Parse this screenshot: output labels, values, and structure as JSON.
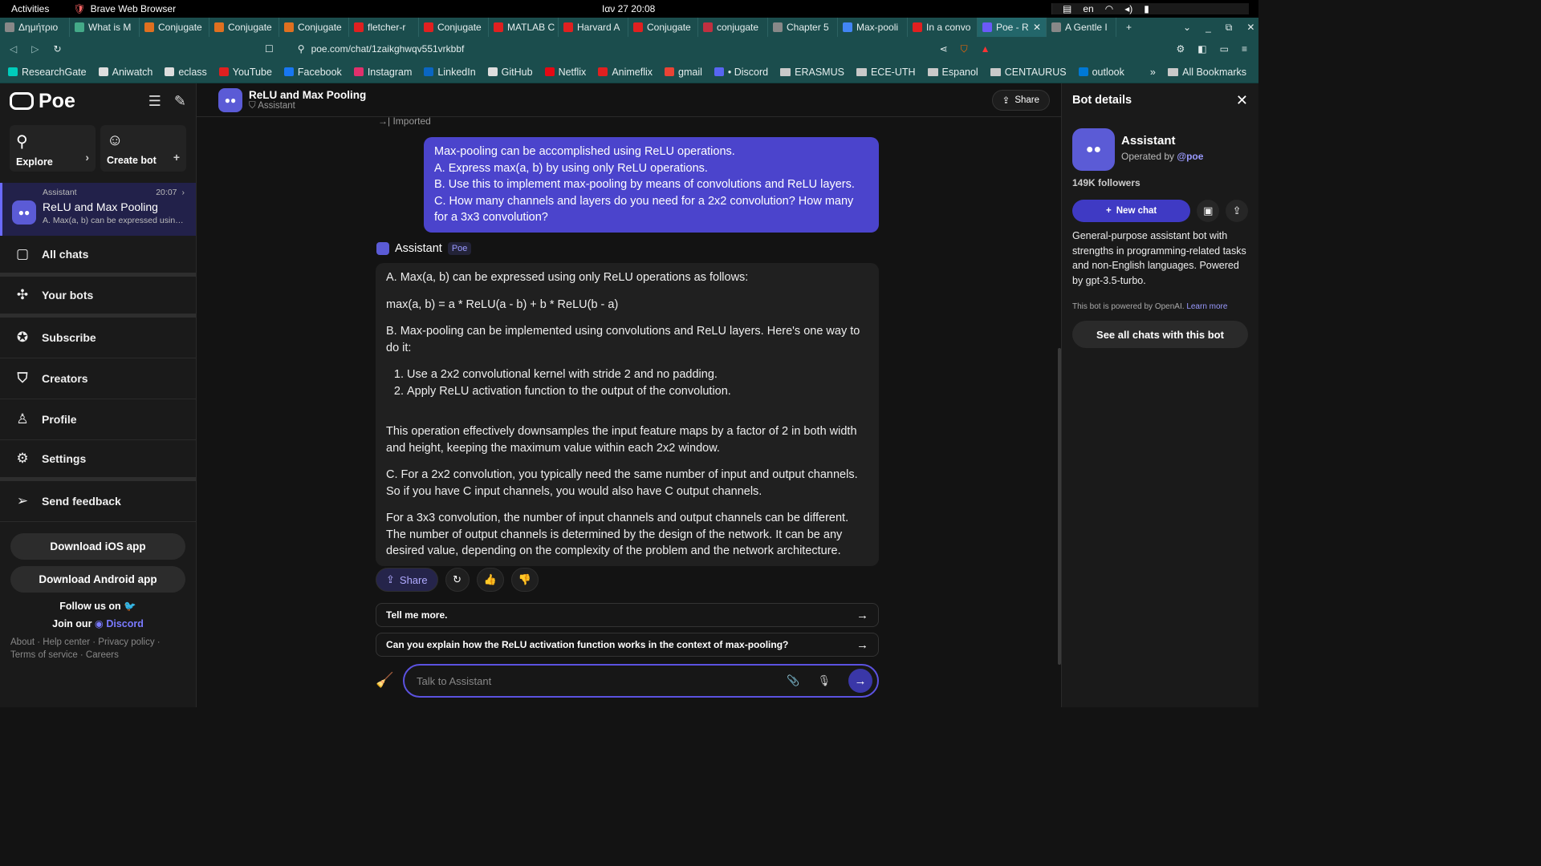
{
  "system": {
    "activities": "Activities",
    "app_name": "Brave Web Browser",
    "clock": "Ιαν 27  20:08",
    "lang": "en"
  },
  "tabs": [
    {
      "label": "Δημήτριο",
      "color": "#888"
    },
    {
      "label": "What is M",
      "color": "#4a8"
    },
    {
      "label": "Conjugate",
      "color": "#e07020"
    },
    {
      "label": "Conjugate",
      "color": "#e07020"
    },
    {
      "label": "Conjugate",
      "color": "#e07020"
    },
    {
      "label": "fletcher-r",
      "color": "#e02020"
    },
    {
      "label": "Conjugate",
      "color": "#e02020"
    },
    {
      "label": "MATLAB C",
      "color": "#e02020"
    },
    {
      "label": "Harvard A",
      "color": "#e02020"
    },
    {
      "label": "Conjugate",
      "color": "#e02020"
    },
    {
      "label": "conjugate",
      "color": "#c03040"
    },
    {
      "label": "Chapter 5",
      "color": "#888"
    },
    {
      "label": "Max-pooli",
      "color": "#4285f4"
    },
    {
      "label": "In a convo",
      "color": "#e02020"
    },
    {
      "label": "Poe - R",
      "color": "#6a5af9",
      "active": true
    },
    {
      "label": "A Gentle I",
      "color": "#888"
    }
  ],
  "url": "poe.com/chat/1zaikghwqv551vrkbbf",
  "bookmarks": [
    {
      "label": "ResearchGate",
      "color": "#00ccbb"
    },
    {
      "label": "Aniwatch",
      "color": "#ddd"
    },
    {
      "label": "eclass",
      "color": "#ddd"
    },
    {
      "label": "YouTube",
      "color": "#e02020"
    },
    {
      "label": "Facebook",
      "color": "#1877f2"
    },
    {
      "label": "Instagram",
      "color": "#e1306c"
    },
    {
      "label": "LinkedIn",
      "color": "#0a66c2"
    },
    {
      "label": "GitHub",
      "color": "#ddd"
    },
    {
      "label": "Netflix",
      "color": "#e50914"
    },
    {
      "label": "Animeflix",
      "color": "#e02020"
    },
    {
      "label": "gmail",
      "color": "#ea4335"
    },
    {
      "label": "• Discord",
      "color": "#5865f2"
    },
    {
      "label": "ERASMUS",
      "folder": true
    },
    {
      "label": "ECE-UTH",
      "folder": true
    },
    {
      "label": "Espanol",
      "folder": true
    },
    {
      "label": "CENTAURUS",
      "folder": true
    },
    {
      "label": "outlook",
      "color": "#0078d4"
    },
    {
      "label": "»",
      "folder": false,
      "color": "transparent"
    },
    {
      "label": "All Bookmarks",
      "folder": true
    }
  ],
  "sidebar": {
    "logo": "Poe",
    "explore": "Explore",
    "create_bot": "Create bot",
    "conversation": {
      "bot": "Assistant",
      "time": "20:07",
      "title": "ReLU and Max Pooling",
      "preview": "A. Max(a, b) can be expressed using on..."
    },
    "nav": [
      {
        "label": "All chats",
        "icon": "chats-icon"
      },
      {
        "label": "Your bots",
        "icon": "bots-icon"
      },
      {
        "label": "Subscribe",
        "icon": "subscribe-icon"
      },
      {
        "label": "Creators",
        "icon": "creators-icon"
      },
      {
        "label": "Profile",
        "icon": "profile-icon"
      },
      {
        "label": "Settings",
        "icon": "settings-icon"
      },
      {
        "label": "Send feedback",
        "icon": "send-icon"
      }
    ],
    "download_ios": "Download iOS app",
    "download_android": "Download Android app",
    "follow_us": "Follow us on",
    "join_our": "Join our",
    "discord": "Discord",
    "footer_line1": "About · Help center · Privacy policy ·",
    "footer_line2": "Terms of service · Careers"
  },
  "chat": {
    "title": "ReLU and Max Pooling",
    "subtitle": "Assistant",
    "share": "Share",
    "imported": "Imported",
    "user_message": [
      "Max-pooling can be accomplished using ReLU operations.",
      "A. Express max(a, b) by using only ReLU operations.",
      "B. Use this to implement max-pooling by means of convolutions and ReLU layers.",
      "C. How many channels and layers do you need for a 2x2 convolution? How many for a 3x3 convolution?"
    ],
    "bot_name": "Assistant",
    "bot_tag": "Poe",
    "bot_p1": "A. Max(a, b) can be expressed using only ReLU operations as follows:",
    "bot_p2": "max(a, b) = a * ReLU(a - b) + b * ReLU(b - a)",
    "bot_p3": "B. Max-pooling can be implemented using convolutions and ReLU layers. Here's one way to do it:",
    "bot_list": [
      "Use a 2x2 convolutional kernel with stride 2 and no padding.",
      "Apply ReLU activation function to the output of the convolution."
    ],
    "bot_p4": "This operation effectively downsamples the input feature maps by a factor of 2 in both width and height, keeping the maximum value within each 2x2 window.",
    "bot_p5": "C. For a 2x2 convolution, you typically need the same number of input and output channels. So if you have C input channels, you would also have C output channels.",
    "bot_p6": "For a 3x3 convolution, the number of input channels and output channels can be different. The number of output channels is determined by the design of the network. It can be any desired value, depending on the complexity of the problem and the network architecture.",
    "share_label": "Share",
    "suggestions": [
      "Tell me more.",
      "Can you explain how the ReLU activation function works in the context of max-pooling?"
    ],
    "placeholder": "Talk to Assistant"
  },
  "details": {
    "title": "Bot details",
    "name": "Assistant",
    "operated_by": "Operated by",
    "operator": "@poe",
    "followers": "149K followers",
    "new_chat": "New chat",
    "description": "General-purpose assistant bot with strengths in programming-related tasks and non-English languages. Powered by gpt-3.5-turbo.",
    "powered": "This bot is powered by OpenAI.",
    "learn_more": "Learn more",
    "see_all": "See all chats with this bot"
  }
}
